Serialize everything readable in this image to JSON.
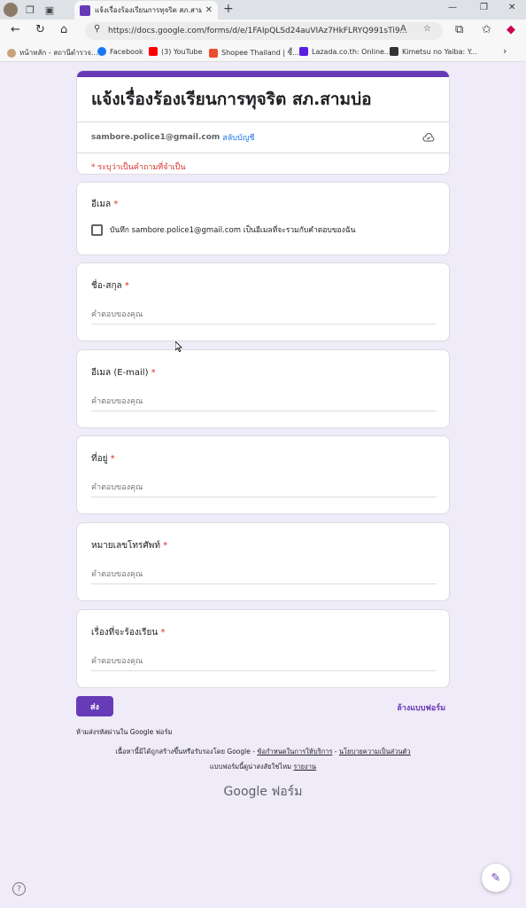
{
  "browser": {
    "tab_title": "แจ้งเรื่องร้องเรียนการทุจริต สภ.สามบ่อ",
    "url": "https://docs.google.com/forms/d/e/1FAIpQLSd24auVIAz7HkFLRYQ991sTi9...",
    "bookmarks": [
      "หน้าหลัก - สถานีตำรวจ...",
      "Facebook",
      "(3) YouTube",
      "Shopee Thailand | ซื้...",
      "Lazada.co.th: Online...",
      "Kimetsu no Yaiba: Y..."
    ]
  },
  "form": {
    "title": "แจ้งเรื่องร้องเรียนการทุจริต สภ.สามบ่อ",
    "account_email": "sambore.police1@gmail.com",
    "switch_account": "สลับบัญชี",
    "required_note": "* ระบุว่าเป็นคำถามที่จำเป็น",
    "required_mark": "*",
    "email_question": {
      "title": "อีเมล",
      "checkbox_label": "บันทึก sambore.police1@gmail.com เป็นอีเมลที่จะรวมกับคำตอบของฉัน"
    },
    "questions": [
      {
        "title": "ชื่อ-สกุล",
        "placeholder": "คำตอบของคุณ"
      },
      {
        "title": "อีเมล (E-mail)",
        "placeholder": "คำตอบของคุณ"
      },
      {
        "title": "ที่อยู่",
        "placeholder": "คำตอบของคุณ"
      },
      {
        "title": "หมายเลขโทรศัพท์",
        "placeholder": "คำตอบของคุณ"
      },
      {
        "title": "เรื่องที่จะร้องเรียน",
        "placeholder": "คำตอบของคุณ"
      }
    ],
    "submit_label": "ส่ง",
    "clear_label": "ล้างแบบฟอร์ม"
  },
  "footer": {
    "no_password": "ห้ามส่งรหัสผ่านใน Google ฟอร์ม",
    "disclaimer_prefix": "เนื้อหานี้มิได้ถูกสร้างขึ้นหรือรับรองโดย Google -",
    "terms_link": "ข้อกำหนดในการให้บริการ",
    "privacy_link": "นโยบายความเป็นส่วนตัว",
    "sep": "-",
    "suspicious": "แบบฟอร์มนี้ดูน่าสงสัยใช่ไหม",
    "report_link": "รายงาน",
    "brand": "Google ฟอร์ม",
    "help": "?"
  },
  "colors": {
    "accent": "#673ab7",
    "background": "#f0ebf8",
    "required": "#d93025",
    "link": "#1a73e8"
  }
}
